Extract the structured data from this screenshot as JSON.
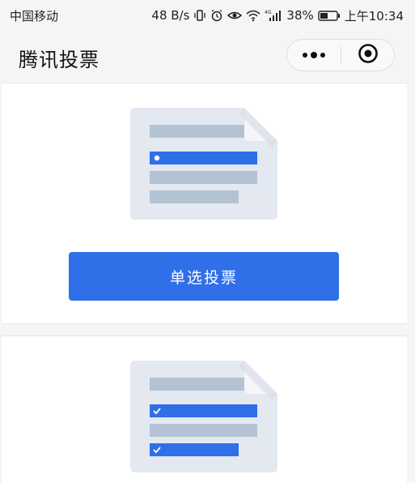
{
  "status_bar": {
    "carrier": "中国移动",
    "speed": "48 B/s",
    "battery": "38%",
    "time": "上午10:34",
    "icons": [
      "vibrate-icon",
      "alarm-icon",
      "eye-icon",
      "wifi-icon",
      "signal-4g-icon",
      "battery-icon"
    ]
  },
  "nav": {
    "title": "腾讯投票",
    "more_icon": "more-dots-icon",
    "close_icon": "target-close-icon"
  },
  "cards": [
    {
      "illustration": "single-choice-document-icon",
      "button_label": "单选投票"
    },
    {
      "illustration": "multi-choice-document-icon"
    }
  ],
  "colors": {
    "accent": "#2f6fe8",
    "doc_bg": "#e4e8f0",
    "doc_line": "#b4c3d3",
    "page_bg": "#f4f5f7"
  }
}
